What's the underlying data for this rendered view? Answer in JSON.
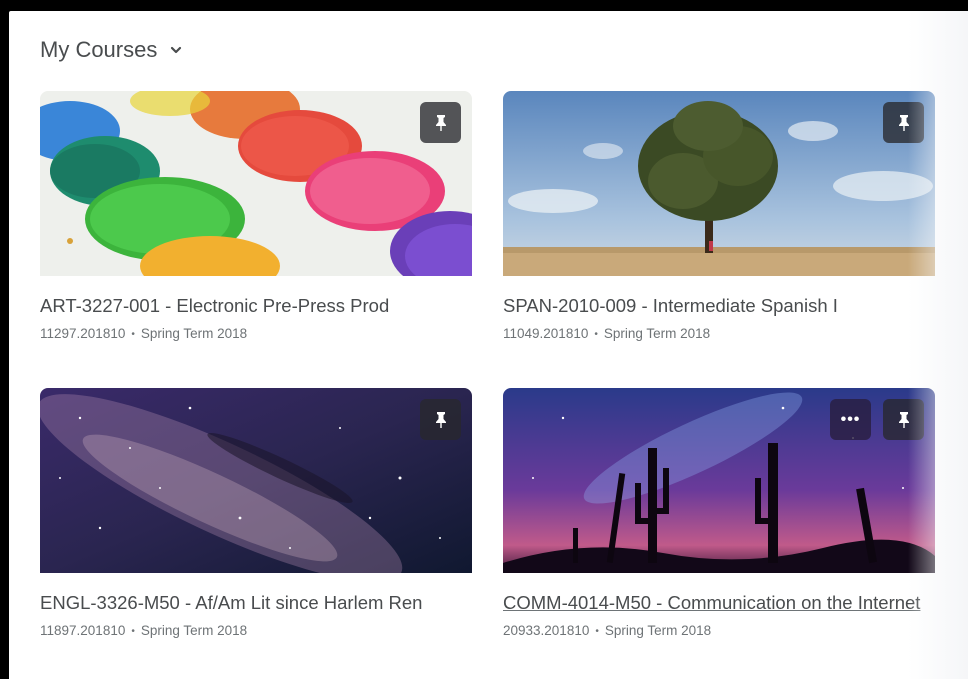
{
  "widget": {
    "title": "My Courses",
    "dropdown_icon": "chevron-down-icon"
  },
  "courses": [
    {
      "title": "ART-3227-001 - Electronic Pre-Press Prod",
      "code": "11297.201810",
      "term": "Spring Term 2018",
      "image": "watercolor-paint-palette",
      "pinned": true
    },
    {
      "title": "SPAN-2010-009 - Intermediate Spanish I",
      "code": "11049.201810",
      "term": "Spring Term 2018",
      "image": "lone-tree-in-field",
      "pinned": true
    },
    {
      "title": "ENGL-3326-M50 - Af/Am Lit since Harlem Ren",
      "code": "11897.201810",
      "term": "Spring Term 2018",
      "image": "milky-way-starfield",
      "pinned": true
    },
    {
      "title": "COMM-4014-M50 - Communication on the Internet",
      "code": "20933.201810",
      "term": "Spring Term 2018",
      "image": "cactus-silhouettes-night-sky",
      "pinned": true,
      "more_label": "•••"
    }
  ],
  "separator": "•",
  "icons": {
    "pin": "pin-icon",
    "more": "more-options-icon"
  }
}
